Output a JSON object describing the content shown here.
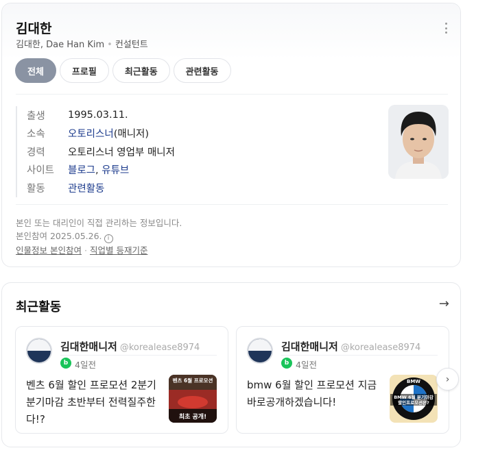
{
  "profile": {
    "name": "김대한",
    "subtitle_name": "김대한, Dae Han Kim",
    "subtitle_job": "컨설턴트",
    "more_icon": "more-vertical-icon"
  },
  "tabs": [
    {
      "label": "전체",
      "active": true
    },
    {
      "label": "프로필",
      "active": false
    },
    {
      "label": "최근활동",
      "active": false
    },
    {
      "label": "관련활동",
      "active": false
    }
  ],
  "info": {
    "birth_label": "출생",
    "birth_value": "1995.03.11.",
    "affiliation_label": "소속",
    "affiliation_link": "오토리스너",
    "affiliation_suffix": "(매니저)",
    "career_label": "경력",
    "career_value": "오토리스너 영업부 매니저",
    "site_label": "사이트",
    "site_link_1": "블로그",
    "site_sep": ",",
    "site_link_2": "유튜브",
    "activity_label": "활동",
    "activity_link": "관련활동"
  },
  "footer": {
    "notice": "본인 또는 대리인이 직접 관리하는 정보입니다.",
    "participation": "본인참여 2025.05.26.",
    "info_icon": "info-icon",
    "link_1": "인물정보 본인참여",
    "link_sep": "·",
    "link_2": "직업별 등재기준"
  },
  "activity": {
    "title": "최근활동",
    "arrow": "→",
    "posts": [
      {
        "author": "김대한매니저",
        "handle": "@korealease8974",
        "age": "4일전",
        "text": "벤츠 6월 할인 프로모션 2분기 분기마감 초반부터 전력질주한다!?",
        "thumb_top": "벤츠 6월 프로모션",
        "thumb_bottom": "최초 공개!"
      },
      {
        "author": "김대한매니저",
        "handle": "@korealease8974",
        "age": "4일전",
        "text": "bmw 6월 할인 프로모션 지금 바로공개하겠습니다!",
        "thumb_logo": "BMW",
        "thumb_line1": "BMW 6월 분기마감",
        "thumb_line2": "할인프로모션은?"
      }
    ],
    "next": "›"
  },
  "colors": {
    "active_tab": "#8a93a3",
    "link": "#1b3a8c",
    "blog_green": "#19c45a"
  }
}
